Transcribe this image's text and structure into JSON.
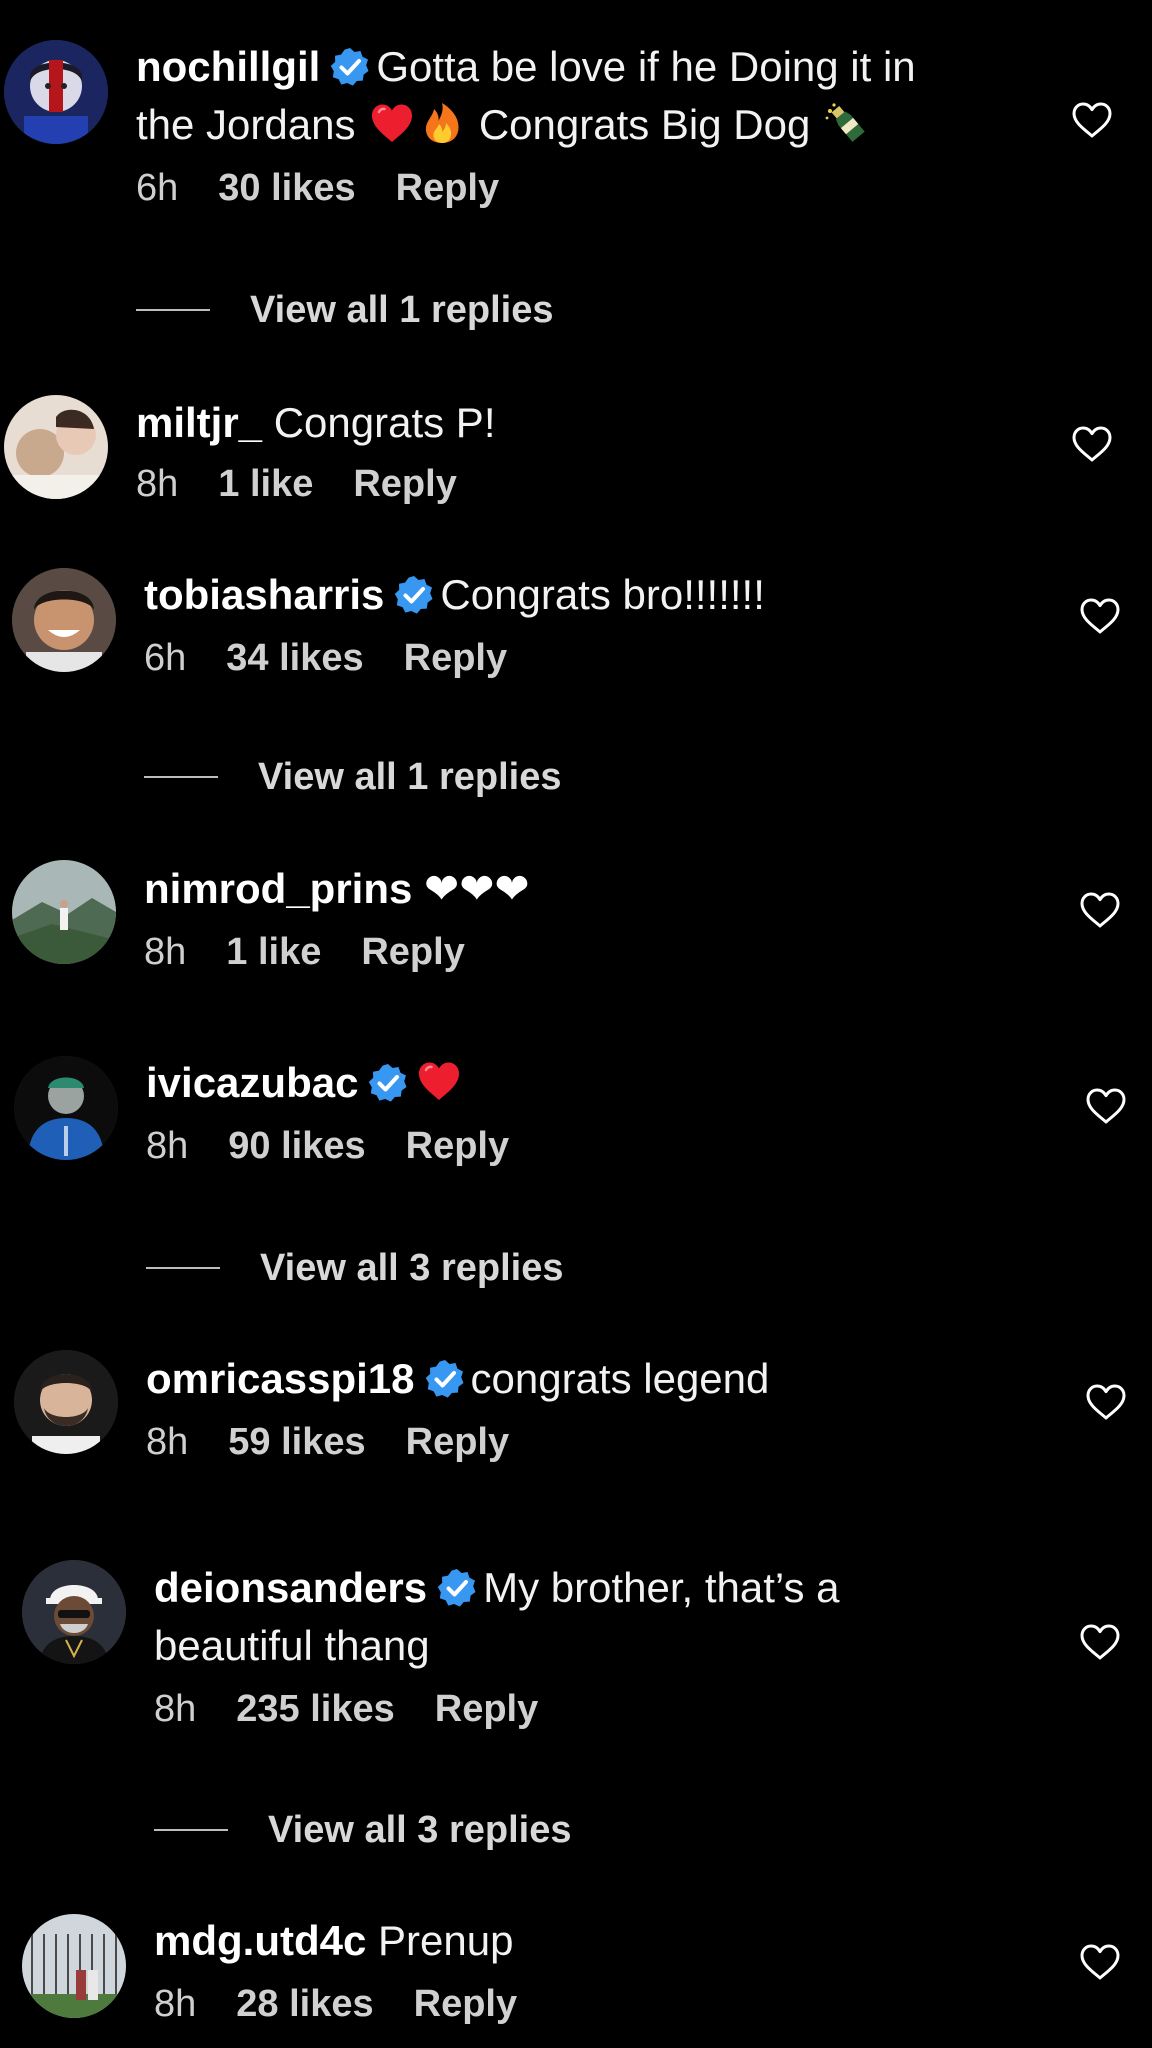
{
  "comments": [
    {
      "username": "nochillgil",
      "verified": true,
      "text1": "Gotta be love if he Doing it in",
      "text2": "the Jordans",
      "text3": "Congrats Big Dog",
      "time": "6h",
      "likes": "30 likes",
      "reply": "Reply",
      "view_replies": "View all 1 replies"
    },
    {
      "username": "miltjr_",
      "verified": false,
      "text": "Congrats P!",
      "time": "8h",
      "likes": "1 like",
      "reply": "Reply"
    },
    {
      "username": "tobiasharris",
      "verified": true,
      "text": "Congrats bro!!!!!!!",
      "time": "6h",
      "likes": "34 likes",
      "reply": "Reply",
      "view_replies": "View all 1 replies"
    },
    {
      "username": "nimrod_prins",
      "verified": false,
      "text": "❤❤❤",
      "time": "8h",
      "likes": "1 like",
      "reply": "Reply"
    },
    {
      "username": "ivicazubac",
      "verified": true,
      "text": "",
      "time": "8h",
      "likes": "90 likes",
      "reply": "Reply",
      "view_replies": "View all 3 replies"
    },
    {
      "username": "omricasspi18",
      "verified": true,
      "text": "congrats legend",
      "time": "8h",
      "likes": "59 likes",
      "reply": "Reply"
    },
    {
      "username": "deionsanders",
      "verified": true,
      "text1": "My brother, that’s a",
      "text2": "beautiful thang",
      "time": "8h",
      "likes": "235 likes",
      "reply": "Reply",
      "view_replies": "View all 3 replies"
    },
    {
      "username": "mdg.utd4c",
      "verified": false,
      "text": "Prenup",
      "time": "8h",
      "likes": "28 likes",
      "reply": "Reply"
    }
  ],
  "colors": {
    "background": "#000000",
    "verified_blue": "#3897f0",
    "heart_red": "#ed1f2f"
  },
  "icons": {
    "verified": "verified-badge-icon",
    "like": "heart-outline-icon",
    "emoji_heart": "red-heart-emoji-icon",
    "emoji_fire": "fire-emoji-icon",
    "emoji_champagne": "champagne-emoji-icon"
  }
}
